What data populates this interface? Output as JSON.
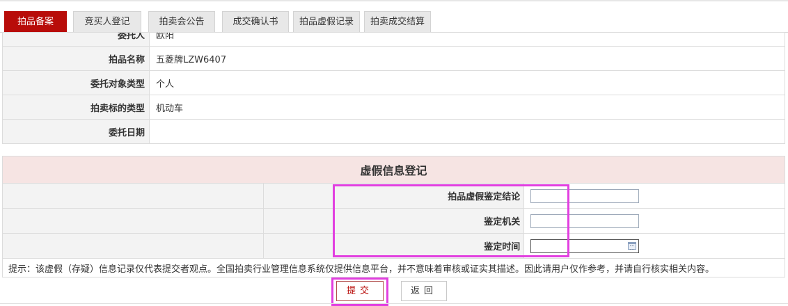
{
  "tabs": [
    {
      "label": "拍品备案",
      "active": true
    },
    {
      "label": "竞买人登记",
      "active": false
    },
    {
      "label": "拍卖会公告",
      "active": false
    },
    {
      "label": "成交确认书",
      "active": false
    },
    {
      "label": "拍品虚假记录",
      "active": false
    },
    {
      "label": "拍卖成交结算",
      "active": false
    }
  ],
  "info": {
    "rows": [
      {
        "label": "委托人",
        "value": "欧阳"
      },
      {
        "label": "拍品名称",
        "value": "五菱牌LZW6407"
      },
      {
        "label": "委托对象类型",
        "value": "个人"
      },
      {
        "label": "拍卖标的类型",
        "value": "机动车"
      },
      {
        "label": "委托日期",
        "value": ""
      }
    ]
  },
  "form": {
    "title": "虚假信息登记",
    "fields": [
      {
        "label": "拍品虚假鉴定结论",
        "value": ""
      },
      {
        "label": "鉴定机关",
        "value": ""
      },
      {
        "label": "鉴定时间",
        "value": ""
      }
    ],
    "tip": "提示：该虚假（存疑）信息记录仅代表提交者观点。全国拍卖行业管理信息系统仅提供信息平台，并不意味着审核或证实其描述。因此请用户仅作参考，并请自行核实相关内容。"
  },
  "buttons": {
    "submit": "提交",
    "back": "返回"
  },
  "colors": {
    "accent": "#b80c09",
    "highlight": "#e23fe0",
    "section_bg": "#f6e4e3"
  }
}
